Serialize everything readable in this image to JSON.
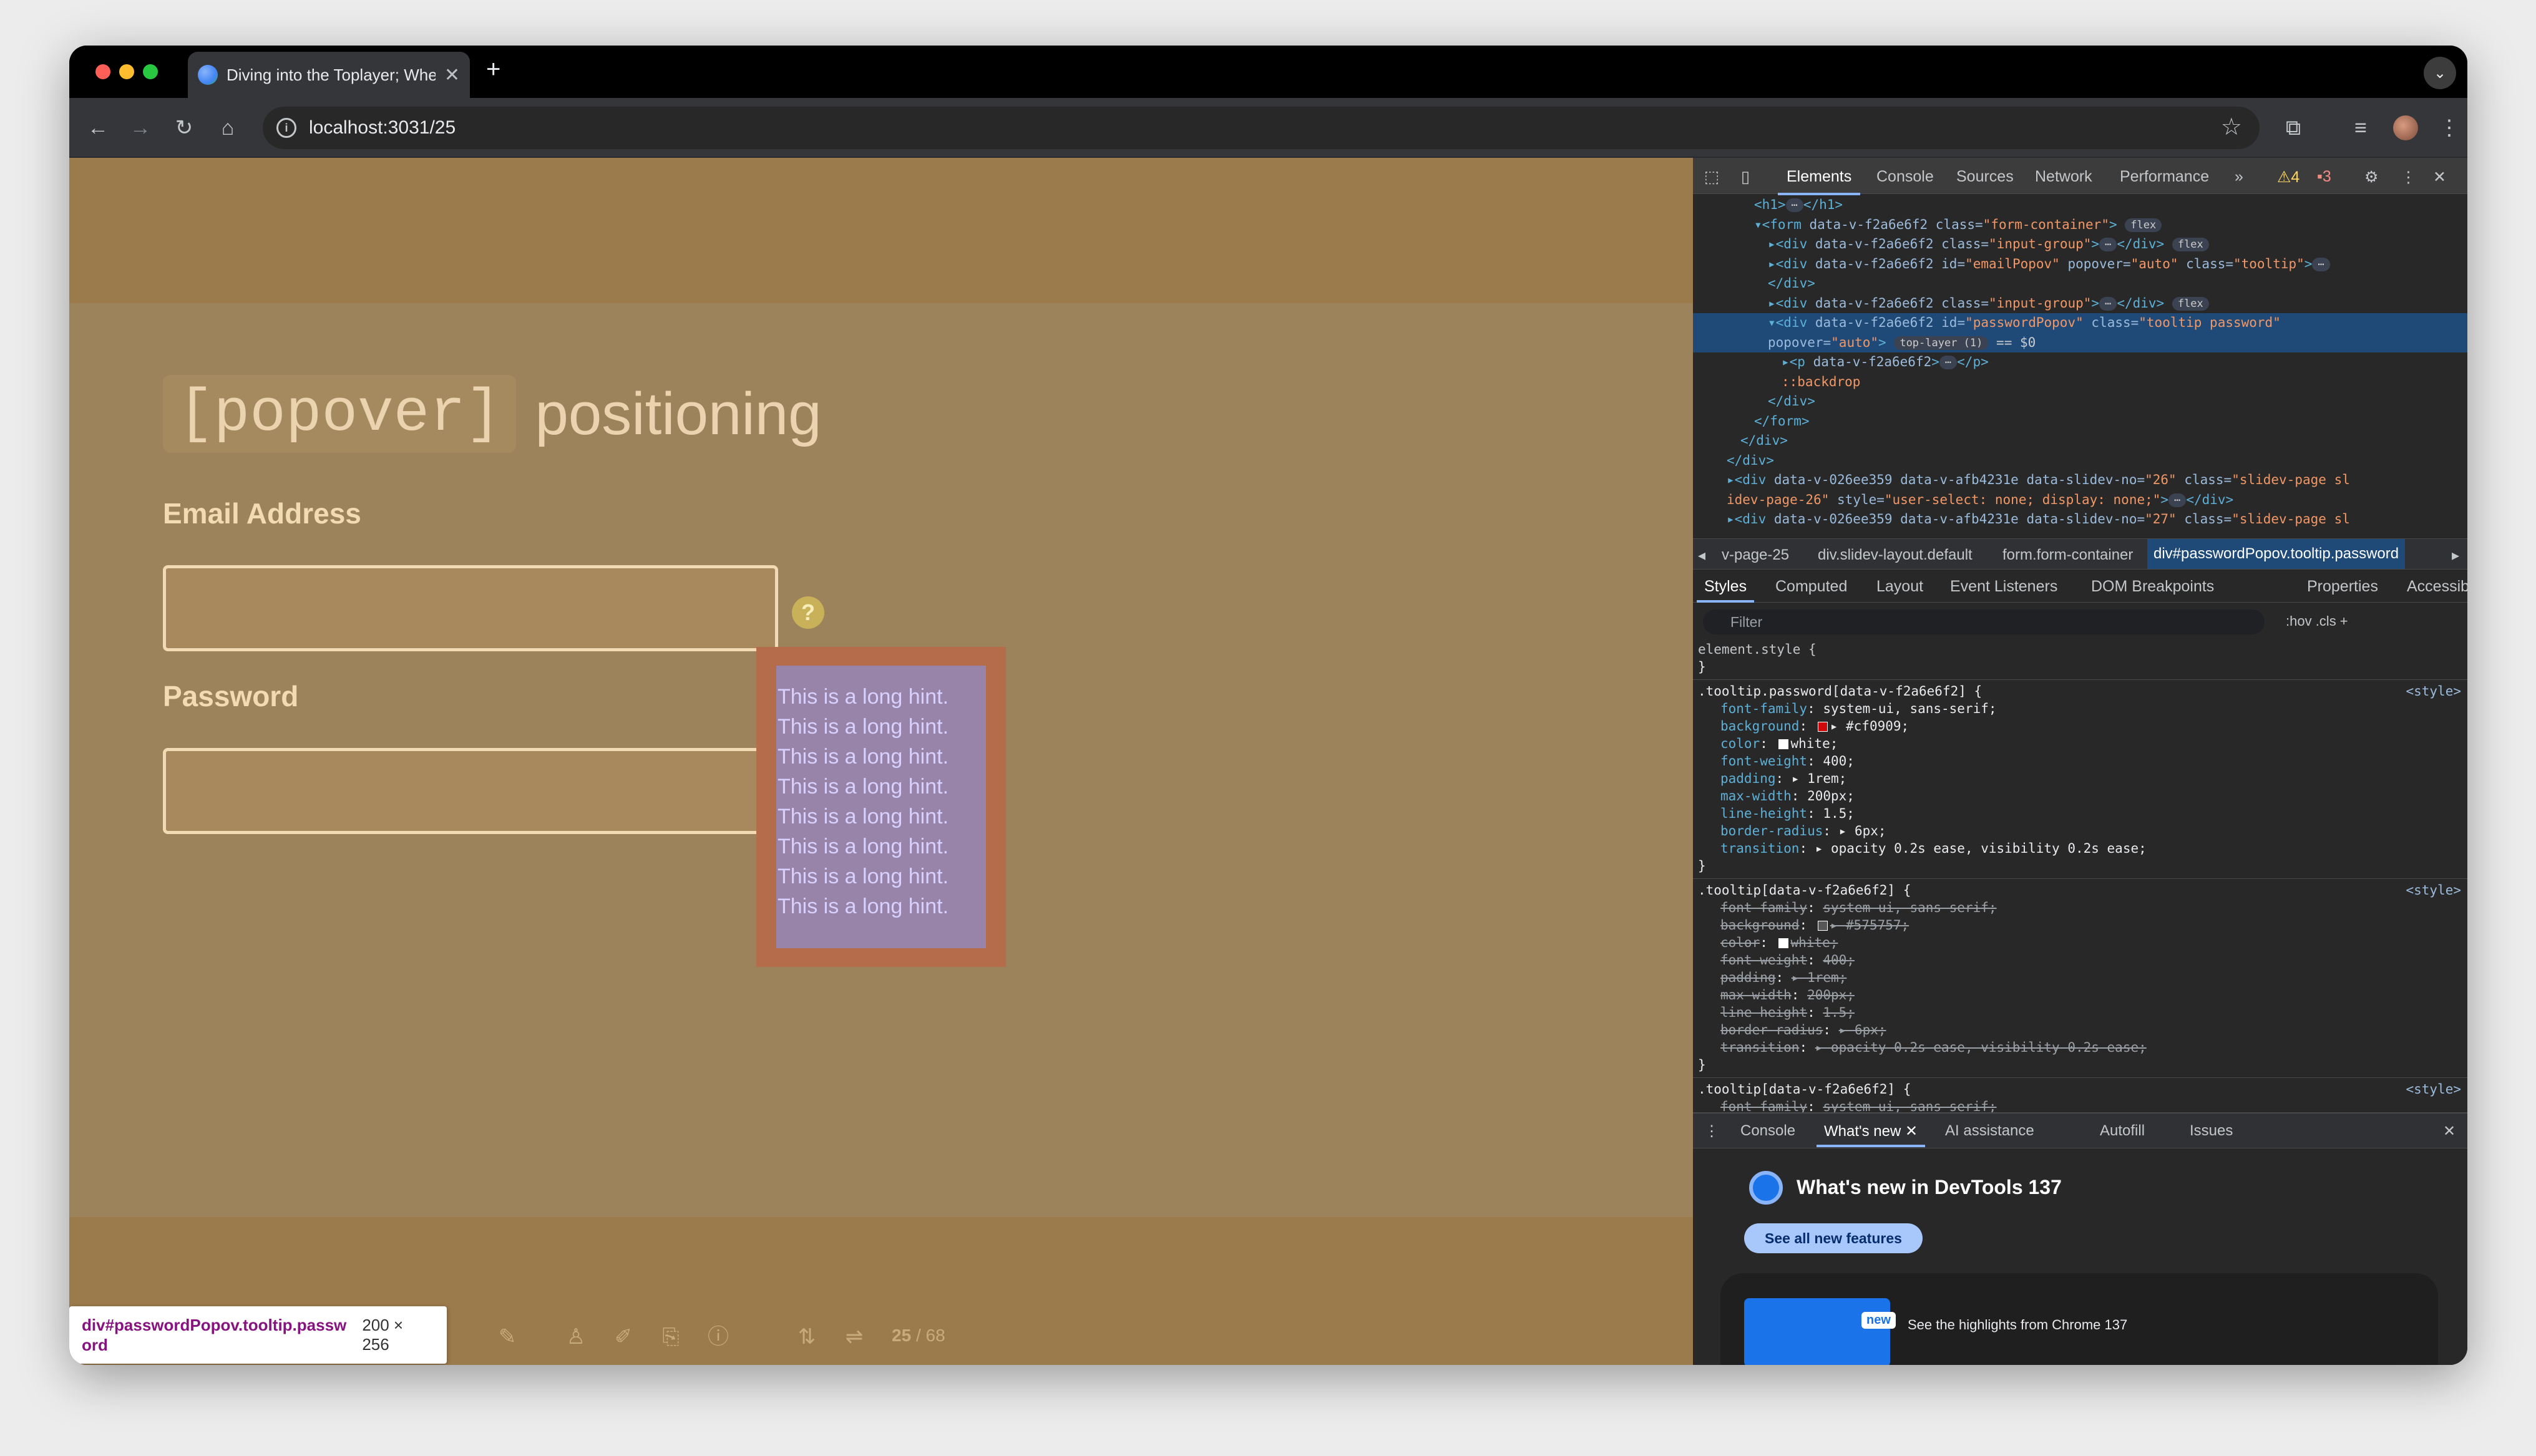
{
  "browser": {
    "tab_title": "Diving into the Toplayer; Whe",
    "url": "localhost:3031/25",
    "colors": {
      "close": "#ff5f57",
      "minimize": "#febc2e",
      "maximize": "#28c840"
    }
  },
  "slide": {
    "title_code": "[popover]",
    "title_word": "positioning",
    "email_label": "Email Address",
    "password_label": "Password",
    "help_icon": "?",
    "hint_lines": [
      "This is a long hint.",
      "This is a long hint.",
      "This is a long hint.",
      "This is a long hint.",
      "This is a long hint.",
      "This is a long hint.",
      "This is a long hint.",
      "This is a long hint."
    ],
    "page_current": "25",
    "page_total": "/ 68"
  },
  "inspect_tooltip": {
    "selector": "div#passwordPopov.tooltip.password",
    "size": "200 × 256"
  },
  "devtools": {
    "tabs": [
      "Elements",
      "Console",
      "Sources",
      "Network",
      "Performance"
    ],
    "warnings": "4",
    "issues": "3",
    "dom_lines": [
      {
        "indent": 4,
        "html": "<span class='tag'>&lt;h1&gt;</span><span class='pill'>⋯</span><span class='tag'>&lt;/h1&gt;</span>"
      },
      {
        "indent": 4,
        "html": "<span class='tag'>▾&lt;form</span> <span class='attr'>data-v-f2a6e6f2 class=</span><span class='val'>\"form-container\"</span><span class='tag'>&gt;</span> <span class='pill'>flex</span>"
      },
      {
        "indent": 5,
        "html": "<span class='tag'>▸&lt;div</span> <span class='attr'>data-v-f2a6e6f2 class=</span><span class='val'>\"input-group\"</span><span class='tag'>&gt;</span><span class='pill'>⋯</span><span class='tag'>&lt;/div&gt;</span> <span class='pill'>flex</span>"
      },
      {
        "indent": 5,
        "html": "<span class='tag'>▸&lt;div</span> <span class='attr'>data-v-f2a6e6f2 id=</span><span class='val'>\"emailPopov\"</span> <span class='attr'>popover=</span><span class='val'>\"auto\"</span> <span class='attr'>class=</span><span class='val'>\"tooltip\"</span><span class='tag'>&gt;</span><span class='pill'>⋯</span>"
      },
      {
        "indent": 5,
        "html": "<span class='tag'>&lt;/div&gt;</span>"
      },
      {
        "indent": 5,
        "html": "<span class='tag'>▸&lt;div</span> <span class='attr'>data-v-f2a6e6f2 class=</span><span class='val'>\"input-group\"</span><span class='tag'>&gt;</span><span class='pill'>⋯</span><span class='tag'>&lt;/div&gt;</span> <span class='pill'>flex</span>"
      },
      {
        "indent": 5,
        "sel": true,
        "html": "<span class='tag'>▾&lt;div</span> <span class='attr'>data-v-f2a6e6f2 id=</span><span class='val'>\"passwordPopov\"</span> <span class='attr'>class=</span><span class='val'>\"tooltip password\"</span>"
      },
      {
        "indent": 5,
        "sel": true,
        "html": "<span class='attr'>popover=</span><span class='val'>\"auto\"</span><span class='tag'>&gt;</span> <span class='pill'>top-layer (1)</span> <span class='txt'>== $0</span>"
      },
      {
        "indent": 6,
        "html": "<span class='tag'>▸&lt;p</span> <span class='attr'>data-v-f2a6e6f2</span><span class='tag'>&gt;</span><span class='pill'>⋯</span><span class='tag'>&lt;/p&gt;</span>"
      },
      {
        "indent": 6,
        "html": "<span class='pseudo'>::backdrop</span>"
      },
      {
        "indent": 5,
        "html": "<span class='tag'>&lt;/div&gt;</span>"
      },
      {
        "indent": 4,
        "html": "<span class='tag'>&lt;/form&gt;</span>"
      },
      {
        "indent": 3,
        "html": "<span class='tag'>&lt;/div&gt;</span>"
      },
      {
        "indent": 2,
        "html": "<span class='tag'>&lt;/div&gt;</span>"
      },
      {
        "indent": 2,
        "html": "<span class='tag'>▸&lt;div</span> <span class='attr'>data-v-026ee359 data-v-afb4231e data-slidev-no=</span><span class='val'>\"26\"</span> <span class='attr'>class=</span><span class='val'>\"slidev-page sl</span>"
      },
      {
        "indent": 2,
        "html": "<span class='val'>idev-page-26\"</span> <span class='attr'>style=</span><span class='val'>\"user-select: none; display: none;\"</span><span class='tag'>&gt;</span><span class='pill'>⋯</span><span class='tag'>&lt;/div&gt;</span>"
      },
      {
        "indent": 2,
        "html": "<span class='tag'>▸&lt;div</span> <span class='attr'>data-v-026ee359 data-v-afb4231e data-slidev-no=</span><span class='val'>\"27\"</span> <span class='attr'>class=</span><span class='val'>\"slidev-page sl</span>"
      }
    ],
    "breadcrumbs": [
      "v-page-25",
      "div.slidev-layout.default",
      "form.form-container",
      "div#passwordPopov.tooltip.password"
    ],
    "subtabs": [
      "Styles",
      "Computed",
      "Layout",
      "Event Listeners",
      "DOM Breakpoints",
      "Properties",
      "Accessibility"
    ],
    "filter_placeholder": "Filter",
    "filter_tools": ":hov  .cls  +",
    "element_style": "element.style {",
    "rule1": {
      "selector": ".tooltip.password[data-v-f2a6e6f2] {",
      "source": "<style>",
      "props": [
        {
          "n": "font-family",
          "v": "system-ui, sans-serif;"
        },
        {
          "n": "background",
          "v": "▸ #cf0909;",
          "swatch": "#cf0909"
        },
        {
          "n": "color",
          "v": "white;",
          "swatch": "#ffffff"
        },
        {
          "n": "font-weight",
          "v": "400;"
        },
        {
          "n": "padding",
          "v": "▸ 1rem;"
        },
        {
          "n": "max-width",
          "v": "200px;"
        },
        {
          "n": "line-height",
          "v": "1.5;"
        },
        {
          "n": "border-radius",
          "v": "▸ 6px;"
        },
        {
          "n": "transition",
          "v": "▸ opacity 0.2s ease, visibility 0.2s ease;"
        }
      ]
    },
    "rule2": {
      "selector": ".tooltip[data-v-f2a6e6f2] {",
      "source": "<style>",
      "props": [
        {
          "n": "font-family",
          "v": "system-ui, sans-serif;"
        },
        {
          "n": "background",
          "v": "▸ #575757;",
          "swatch": "#575757"
        },
        {
          "n": "color",
          "v": "white;",
          "swatch": "#ffffff"
        },
        {
          "n": "font-weight",
          "v": "400;"
        },
        {
          "n": "padding",
          "v": "▸ 1rem;"
        },
        {
          "n": "max-width",
          "v": "200px;"
        },
        {
          "n": "line-height",
          "v": "1.5;"
        },
        {
          "n": "border-radius",
          "v": "▸ 6px;"
        },
        {
          "n": "transition",
          "v": "▸ opacity 0.2s ease, visibility 0.2s ease;"
        }
      ]
    },
    "rule3": {
      "selector": ".tooltip[data-v-f2a6e6f2] {",
      "source": "<style>",
      "props": [
        {
          "n": "font-family",
          "v": "system-ui, sans-serif;"
        }
      ]
    },
    "drawer_tabs": [
      "Console",
      "What's new",
      "AI assistance",
      "Autofill",
      "Issues"
    ],
    "whats_new_title": "What's new in DevTools 137",
    "see_all_button": "See all new features",
    "badge_new": "new",
    "highlights_text": "See the highlights from Chrome 137"
  }
}
